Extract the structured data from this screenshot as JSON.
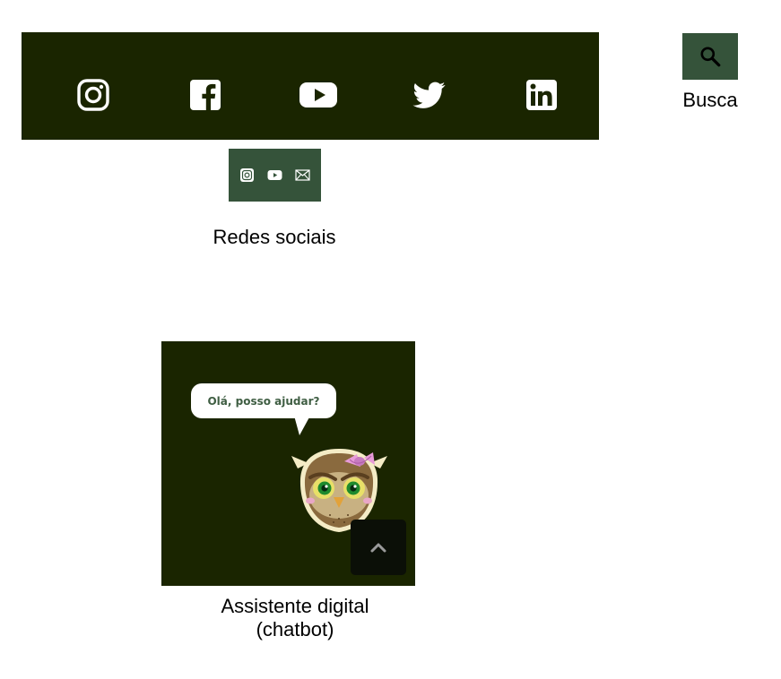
{
  "social_bar": {
    "icons": [
      {
        "name": "instagram-icon"
      },
      {
        "name": "facebook-icon"
      },
      {
        "name": "youtube-icon"
      },
      {
        "name": "twitter-icon"
      },
      {
        "name": "linkedin-icon"
      }
    ],
    "background": "#1a2500",
    "icon_color": "#ffffff"
  },
  "search": {
    "icon": "search-icon",
    "label": "Busca",
    "button_color": "#35533a"
  },
  "mini_social": {
    "icons": [
      "instagram-icon",
      "youtube-icon",
      "mail-icon"
    ],
    "label": "Redes sociais",
    "background": "#35533a"
  },
  "chatbot": {
    "bubble_text": "Olá, posso ajudar?",
    "label_line1": "Assistente digital",
    "label_line2": "(chatbot)",
    "mascot": "owl-mascot-icon",
    "scroll_icon": "chevron-up-icon",
    "background": "#1a2500"
  }
}
